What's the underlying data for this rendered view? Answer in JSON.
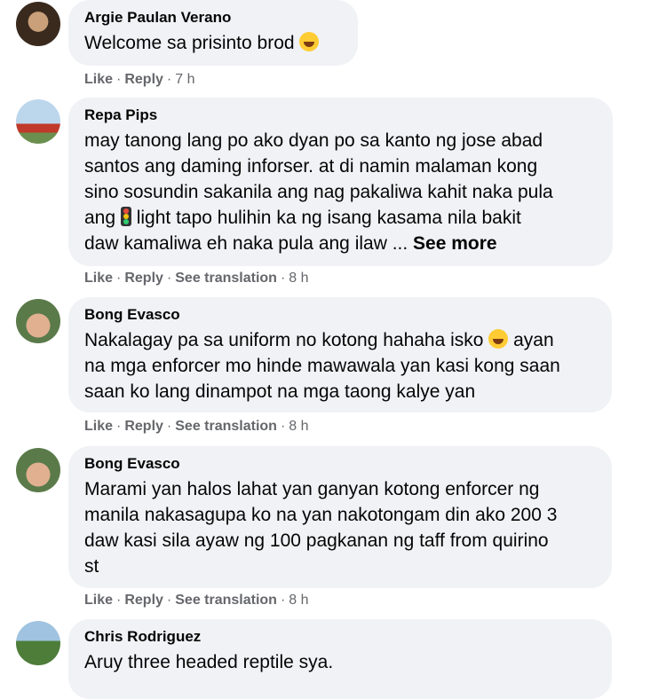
{
  "comments": [
    {
      "author": "Argie Paulan Verano",
      "text": "Welcome sa prisinto brod ",
      "actions": {
        "like": "Like",
        "reply": "Reply",
        "time": "7 h"
      }
    },
    {
      "author": "Repa Pips",
      "line1": "may tanong lang po ako dyan po sa kanto ng jose abad",
      "line2": "santos ang daming inforser. at di namin malaman kong",
      "line3": "sino sosundin sakanila ang nag pakaliwa kahit naka pula",
      "line4a": "ang ",
      "line4b": " light tapo hulihin ka ng isang kasama nila bakit",
      "line5": "daw kamaliwa eh naka pula ang ilaw ... ",
      "see_more": "See more",
      "actions": {
        "like": "Like",
        "reply": "Reply",
        "translation": "See translation",
        "time": "8 h"
      }
    },
    {
      "author": "Bong Evasco",
      "line1a": "Nakalagay pa sa uniform no kotong hahaha isko ",
      "line1b": " ayan",
      "line2": "na mga enforcer mo hinde mawawala yan kasi kong saan",
      "line3": "saan ko lang dinampot na mga taong kalye yan",
      "actions": {
        "like": "Like",
        "reply": "Reply",
        "translation": "See translation",
        "time": "8 h"
      }
    },
    {
      "author": "Bong Evasco",
      "line1": "Marami yan halos lahat yan ganyan kotong enforcer ng",
      "line2": "manila nakasagupa ko na yan nakotongam din ako 200 3",
      "line3": "daw kasi sila ayaw ng 100 pagkanan ng taff from quirino",
      "line4": "st",
      "actions": {
        "like": "Like",
        "reply": "Reply",
        "translation": "See translation",
        "time": "8 h"
      }
    },
    {
      "author": "Chris Rodriguez",
      "text": "Aruy three headed reptile sya."
    }
  ],
  "colors": {
    "bubble": "#f0f2f5",
    "meta": "#65676b",
    "text": "#050505"
  }
}
